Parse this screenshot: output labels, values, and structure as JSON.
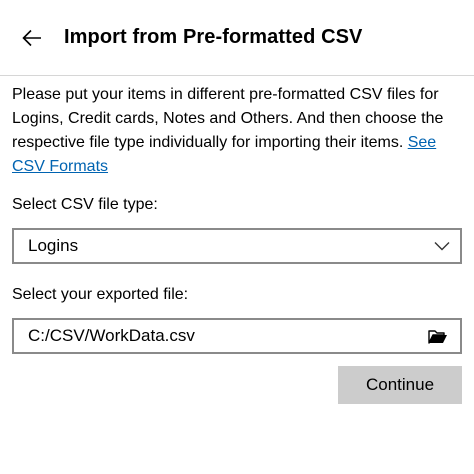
{
  "header": {
    "title": "Import from Pre-formatted CSV",
    "back_icon": "arrow-left-icon"
  },
  "description": {
    "text": "Please put your items in different pre-formatted CSV files for Logins, Credit cards, Notes and Others. And then choose the respective file type individually for importing their items. ",
    "link_text": "See CSV Formats",
    "link_color": "#0063b1"
  },
  "file_type": {
    "label": "Select CSV file type:",
    "selected": "Logins",
    "icon": "chevron-down-icon"
  },
  "exported_file": {
    "label": "Select your exported file:",
    "value": "C:/CSV/WorkData.csv",
    "icon": "folder-open-icon"
  },
  "actions": {
    "continue_label": "Continue",
    "continue_bg": "#cccccc"
  }
}
